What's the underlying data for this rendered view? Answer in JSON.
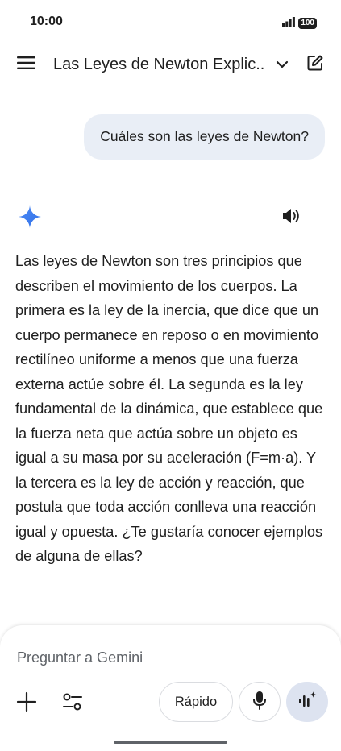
{
  "status_bar": {
    "time": "10:00",
    "battery": "100",
    "signal_icon": "signal-bars-icon"
  },
  "header": {
    "menu_icon": "menu-icon",
    "title": "Las Leyes de Newton Explic...",
    "chevron_icon": "chevron-down-icon",
    "edit_icon": "new-chat-edit-icon"
  },
  "conversation": {
    "user_message": "Cuáles son las leyes de Newton?",
    "gemini_icon": "gemini-sparkle-icon",
    "speaker_icon": "speaker-icon",
    "response": "Las leyes de Newton son tres principios que describen el movimiento de los cuerpos. La primera es la ley de la inercia, que dice que un cuerpo permanece en reposo o en movimiento rectilíneo uniforme a menos que una fuerza externa actúe sobre él. La segunda es la ley fundamental de la dinámica, que establece que la fuerza neta que actúa sobre un objeto es igual a su masa por su aceleración (F=m·a). Y la tercera es la ley de acción y reacción, que postula que toda acción conlleva una reacción igual y opuesta. ¿Te gustaría conocer ejemplos de alguna de ellas?"
  },
  "composer": {
    "placeholder": "Preguntar a Gemini",
    "value": "",
    "mode_label": "Rápido",
    "plus_icon": "plus-icon",
    "tools_icon": "tools-sliders-icon",
    "mic_icon": "microphone-icon",
    "live_icon": "live-waveform-icon"
  },
  "colors": {
    "bubble": "#e9eef6",
    "gemini_blue": "#4285f4",
    "live_button": "#dde3f0",
    "text": "#1f1f1f"
  }
}
